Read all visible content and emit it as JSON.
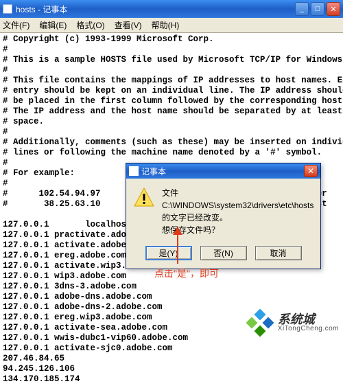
{
  "window": {
    "title": "hosts - 记事本"
  },
  "menu": {
    "file": "文件(F)",
    "edit": "编辑(E)",
    "format": "格式(O)",
    "view": "查看(V)",
    "help": "帮助(H)"
  },
  "content": {
    "text": "# Copyright (c) 1993-1999 Microsoft Corp.\n#\n# This is a sample HOSTS file used by Microsoft TCP/IP for Windows.\n#\n# This file contains the mappings of IP addresses to host names. Each\n# entry should be kept on an individual line. The IP address should\n# be placed in the first column followed by the corresponding host name.\n# The IP address and the host name should be separated by at least one\n# space.\n#\n# Additionally, comments (such as these) may be inserted on individual\n# lines or following the machine name denoted by a '#' symbol.\n#\n# For example:\n#\n#      102.54.94.97     rhino.acme.com          # source server\n#       38.25.63.10     x.acme.com              # x client host\n\n127.0.0.1       localhost\n127.0.0.1 practivate.adobe.com\n127.0.0.1 activate.adobe.com\n127.0.0.1 ereg.adobe.com\n127.0.0.1 activate.wip3.adobe.com\n127.0.0.1 wip3.adobe.com\n127.0.0.1 3dns-3.adobe.com\n127.0.0.1 adobe-dns.adobe.com\n127.0.0.1 adobe-dns-2.adobe.com\n127.0.0.1 ereg.wip3.adobe.com\n127.0.0.1 activate-sea.adobe.com\n127.0.0.1 wwis-dubc1-vip60.adobe.com\n127.0.0.1 activate-sjc0.adobe.com\n207.46.84.65\n94.245.126.106\n134.170.185.174"
  },
  "dialog": {
    "title": "记事本",
    "line1": "文件 C:\\WINDOWS\\system32\\drivers\\etc\\hosts 的文字已经改变。",
    "line2": "想保存文件吗？",
    "yes": "是(Y)",
    "no": "否(N)",
    "cancel": "取消"
  },
  "annotation": {
    "text": "点击\"是\"，即可"
  },
  "watermark": {
    "cn": "系统城",
    "en": "XiTongCheng.com"
  }
}
